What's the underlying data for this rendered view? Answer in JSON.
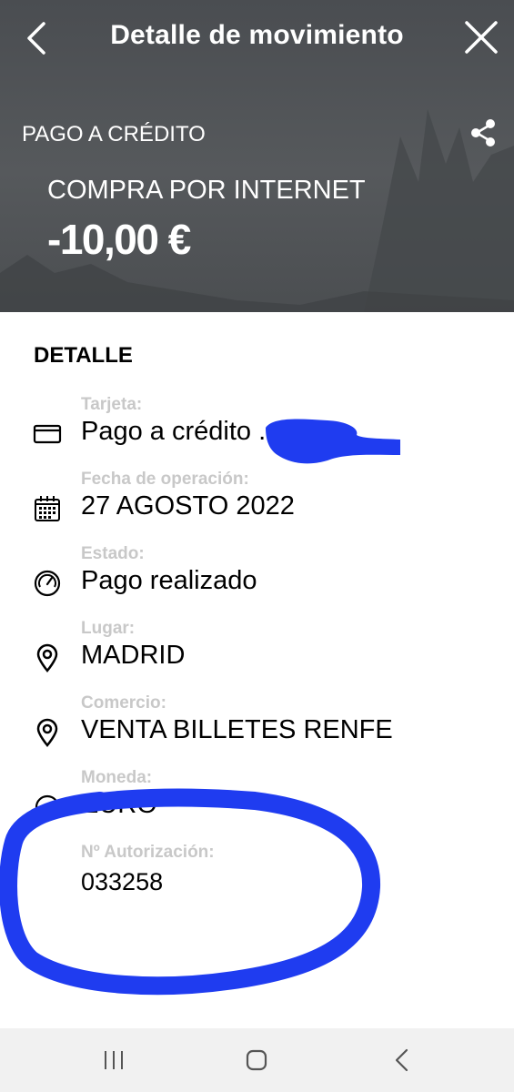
{
  "header": {
    "title": "Detalle de movimiento",
    "kind": "PAGO A CRÉDITO",
    "concept": "COMPRA POR INTERNET",
    "amount": "-10,00 €"
  },
  "detail": {
    "section_title": "DETALLE",
    "rows": [
      {
        "label": "Tarjeta:",
        "value": "Pago a crédito ...",
        "icon": "card-icon"
      },
      {
        "label": "Fecha de operación:",
        "value": "27 AGOSTO 2022",
        "icon": "calendar-icon"
      },
      {
        "label": "Estado:",
        "value": "Pago realizado",
        "icon": "gauge-icon"
      },
      {
        "label": "Lugar:",
        "value": "MADRID",
        "icon": "location-pin-icon"
      },
      {
        "label": "Comercio:",
        "value": "VENTA BILLETES RENFE",
        "icon": "location-pin-icon"
      },
      {
        "label": "Moneda:",
        "value": "EURO",
        "icon": "currency-icon"
      },
      {
        "label": "Nº Autorización:",
        "value": "033258",
        "icon": ""
      }
    ]
  },
  "colors": {
    "hero_bg": "#4f5255",
    "label_gray": "#c8c8c8",
    "scribble_blue": "#1f3cf0",
    "navbar_bg": "#f1f1f1"
  },
  "navbar": {
    "icons": [
      "recent-apps-icon",
      "home-icon",
      "back-nav-icon"
    ]
  }
}
